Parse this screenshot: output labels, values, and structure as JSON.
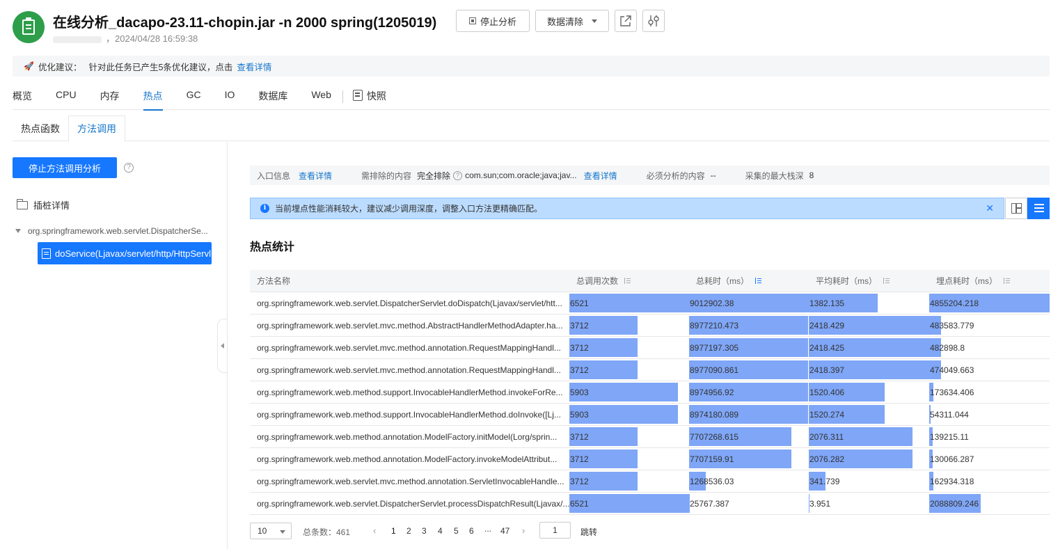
{
  "header": {
    "title": "在线分析_dacapo-23.11-chopin.jar -n 2000 spring(1205019)",
    "subtitle": "，2024/04/28 16:59:38",
    "stop_analysis_label": "停止分析",
    "clear_data_label": "数据清除"
  },
  "suggestion": {
    "label": "优化建议：",
    "text": "针对此任务已产生5条优化建议，点击",
    "link": "查看详情"
  },
  "main_tabs": [
    "概览",
    "CPU",
    "内存",
    "热点",
    "GC",
    "IO",
    "数据库",
    "Web"
  ],
  "snapshot_label": "快照",
  "sub_tabs": [
    "热点函数",
    "方法调用"
  ],
  "left_panel": {
    "stop_method_label": "停止方法调用分析",
    "stub_detail_label": "插桩详情",
    "tree_root": "org.springframework.web.servlet.DispatcherSe...",
    "tree_child": "doService(Ljavax/servlet/http/HttpServl..."
  },
  "info_bar": {
    "entry_label": "入口信息",
    "entry_link": "查看详情",
    "exclude_label": "需排除的内容",
    "exclude_mode": "完全排除",
    "exclude_value": "com.sun;com.oracle;java;jav...",
    "exclude_link": "查看详情",
    "required_label": "必须分析的内容",
    "required_value": "--",
    "max_depth_label": "采集的最大栈深",
    "max_depth_value": "8"
  },
  "alert_text": "当前埋点性能消耗较大，建议减少调用深度，调整入口方法更精确匹配。",
  "section_title": "热点统计",
  "table": {
    "headers": [
      "方法名称",
      "总调用次数",
      "总耗时（ms）",
      "平均耗时（ms）",
      "埋点耗时（ms）"
    ],
    "rows": [
      {
        "name": "org.springframework.web.servlet.DispatcherServlet.doDispatch(Ljavax/servlet/htt...",
        "calls": "6521",
        "total": "9012902.38",
        "avg": "1382.135",
        "probe": "4855204.218"
      },
      {
        "name": "org.springframework.web.servlet.mvc.method.AbstractHandlerMethodAdapter.ha...",
        "calls": "3712",
        "total": "8977210.473",
        "avg": "2418.429",
        "probe": "483583.779"
      },
      {
        "name": "org.springframework.web.servlet.mvc.method.annotation.RequestMappingHandl...",
        "calls": "3712",
        "total": "8977197.305",
        "avg": "2418.425",
        "probe": "482898.8"
      },
      {
        "name": "org.springframework.web.servlet.mvc.method.annotation.RequestMappingHandl...",
        "calls": "3712",
        "total": "8977090.861",
        "avg": "2418.397",
        "probe": "474049.663"
      },
      {
        "name": "org.springframework.web.method.support.InvocableHandlerMethod.invokeForRe...",
        "calls": "5903",
        "total": "8974956.92",
        "avg": "1520.406",
        "probe": "173634.406"
      },
      {
        "name": "org.springframework.web.method.support.InvocableHandlerMethod.doInvoke([Lj...",
        "calls": "5903",
        "total": "8974180.089",
        "avg": "1520.274",
        "probe": "54311.044"
      },
      {
        "name": "org.springframework.web.method.annotation.ModelFactory.initModel(Lorg/sprin...",
        "calls": "3712",
        "total": "7707268.615",
        "avg": "2076.311",
        "probe": "139215.11"
      },
      {
        "name": "org.springframework.web.method.annotation.ModelFactory.invokeModelAttribut...",
        "calls": "3712",
        "total": "7707159.91",
        "avg": "2076.282",
        "probe": "130066.287"
      },
      {
        "name": "org.springframework.web.servlet.mvc.method.annotation.ServletInvocableHandle...",
        "calls": "3712",
        "total": "1268536.03",
        "avg": "341.739",
        "probe": "162934.318"
      },
      {
        "name": "org.springframework.web.servlet.DispatcherServlet.processDispatchResult(Ljavax/...",
        "calls": "6521",
        "total": "25767.387",
        "avg": "3.951",
        "probe": "2088809.246"
      }
    ]
  },
  "pagination": {
    "page_size": "10",
    "total_label": "总条数：461",
    "pages": [
      "1",
      "2",
      "3",
      "4",
      "5",
      "6",
      "...",
      "47"
    ],
    "jump_value": "1",
    "jump_label": "跳转"
  },
  "colors": {
    "accent": "#1677ff",
    "bar": "#7fa6f7",
    "app_icon": "#2e9e4a"
  }
}
